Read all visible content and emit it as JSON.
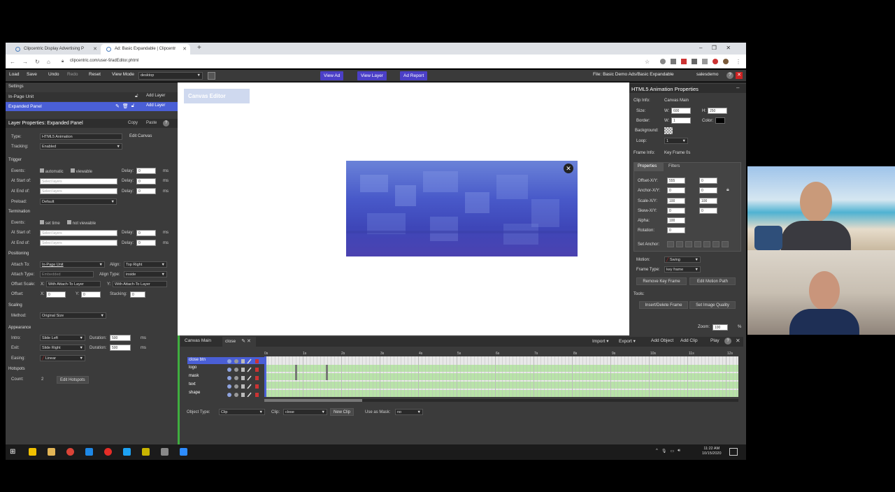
{
  "browser": {
    "tabs": [
      {
        "label": "Clipcentric Display Advertising P"
      },
      {
        "label": "Ad: Basic Expandable | Clipcentr"
      }
    ],
    "url": "clipcentric.com/user-9/adEditor.phtml"
  },
  "toolbar": {
    "load": "Load",
    "save": "Save",
    "undo": "Undo",
    "redo": "Redo",
    "reset": "Reset",
    "view_mode_label": "View Mode",
    "view_mode_value": "desktop",
    "view_ad": "View Ad",
    "view_layer": "View Layer",
    "ad_report": "Ad Report",
    "file_label": "File: Basic Demo Ads/Basic Expandable",
    "user": "salesdemo"
  },
  "left": {
    "settings": "Settings",
    "inpage_unit": "In-Page Unit",
    "add_layer": "Add Layer",
    "expanded_panel": "Expanded Panel",
    "layer_props_title": "Layer Properties: Expanded Panel",
    "copy": "Copy",
    "paste": "Paste",
    "type_label": "Type:",
    "type_value": "HTML5 Animation",
    "edit_canvas": "Edit Canvas",
    "tracking_label": "Tracking:",
    "tracking_value": "Enabled",
    "trigger": "Trigger",
    "events_label": "Events:",
    "automatic": "automatic",
    "viewable": "viewable",
    "delay": "Delay:",
    "delay_value": "0",
    "ms": "ms",
    "at_start": "At Start of:",
    "at_end": "At End of:",
    "select_layers": "Select layers",
    "preload_label": "Preload:",
    "preload_value": "Default",
    "termination": "Termination",
    "set_time": "set time",
    "not_viewable": "not viewable",
    "positioning": "Positioning",
    "attach_to_label": "Attach To:",
    "attach_to_value": "In-Page Unit",
    "align_label": "Align:",
    "align_value": "Top Right",
    "attach_type_label": "Attach Type:",
    "attach_type_value": "Embedded",
    "align_type_label": "Align Type:",
    "align_type_value": "inside",
    "offset_scale_label": "Offset Scale:",
    "x": "X:",
    "y": "Y:",
    "with_attach": "With Attach-To Layer",
    "offset_label": "Offset:",
    "stacking": "Stacking:",
    "zero": "0",
    "scaling": "Scaling",
    "method_label": "Method:",
    "method_value": "Original Size",
    "appearance": "Appearance",
    "intro_label": "Intro:",
    "intro_value": "Slide Left",
    "duration": "Duration:",
    "duration_value": "500",
    "exit_label": "Exit:",
    "exit_value": "Slide Right",
    "easing_label": "Easing:",
    "easing_value": "Linear",
    "hotspots": "Hotspots",
    "count_label": "Count:",
    "count_value": "2",
    "edit_hotspots": "Edit Hotspots"
  },
  "canvas": {
    "title": "Canvas Editor"
  },
  "right": {
    "title": "HTML5 Animation Properties",
    "clip_info": "Clip Info:",
    "clip_name": "Canvas Main",
    "size": "Size:",
    "w": "W:",
    "h": "H:",
    "w_value": "600",
    "h_value": "250",
    "border": "Border:",
    "border_w": "1",
    "color": "Color:",
    "background": "Background:",
    "loop": "Loop:",
    "loop_value": "1",
    "frame_info": "Frame Info:",
    "frame_name": "Key Frame 0s",
    "properties_tab": "Properties",
    "filters_tab": "Filters",
    "offset_xy": "Offset-X/Y:",
    "offset_x": "555",
    "offset_y": "0",
    "anchor_xy": "Anchor-X/Y:",
    "anchor_x": "0",
    "anchor_y": "0",
    "scale_xy": "Scale-X/Y:",
    "scale_x": "100",
    "scale_y": "100",
    "skew_xy": "Skew-X/Y:",
    "skew_x": "0",
    "skew_y": "0",
    "alpha": "Alpha:",
    "alpha_value": "100",
    "rotation": "Rotation:",
    "rotation_value": "0",
    "set_anchor": "Set Anchor:",
    "motion": "Motion:",
    "motion_value": "Swing",
    "frame_type": "Frame Type:",
    "frame_type_value": "key frame",
    "remove_key_frame": "Remove Key Frame",
    "edit_motion_path": "Edit Motion Path",
    "tools": "Tools:",
    "insert_delete": "Insert/Delete Frame",
    "set_image_quality": "Set Image Quality",
    "zoom": "Zoom:",
    "zoom_value": "100",
    "percent": "%"
  },
  "timeline": {
    "canvas_main": "Canvas Main",
    "close": "close",
    "import": "Import",
    "export": "Export",
    "add_object": "Add Object",
    "add_clip": "Add Clip",
    "play": "Play",
    "tracks": [
      "close btn",
      "logo",
      "mask",
      "text",
      "shape"
    ],
    "ticks": [
      "0s",
      "1s",
      "2s",
      "3s",
      "4s",
      "5s",
      "6s",
      "7s",
      "8s",
      "9s",
      "10s",
      "11s",
      "12s"
    ],
    "object_type_label": "Object Type:",
    "object_type_value": "Clip",
    "clip_label": "Clip:",
    "clip_value": "close",
    "new_clip": "New Clip",
    "use_as_mask_label": "Use as Mask:",
    "use_as_mask_value": "no"
  },
  "taskbar": {
    "time": "11:22 AM",
    "date": "10/15/2020"
  },
  "colors": {
    "accent": "#4b3fc7",
    "selected": "#4a5fd6",
    "easing": "#cc2222"
  }
}
